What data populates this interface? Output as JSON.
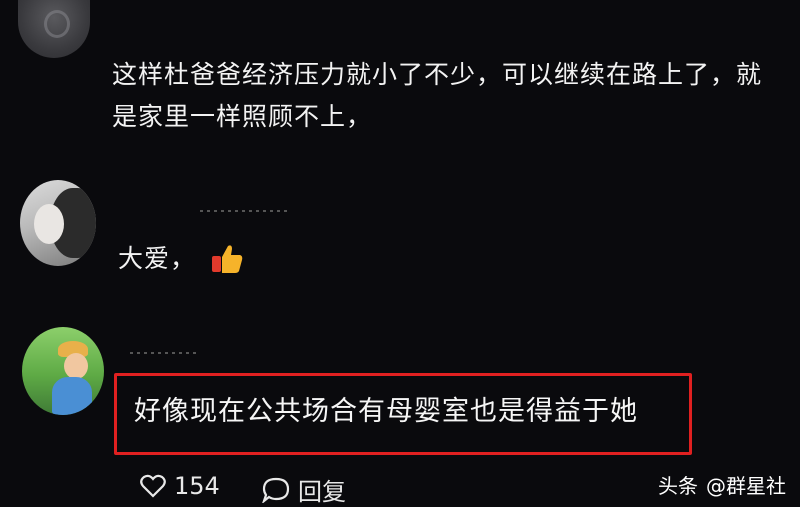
{
  "comments": [
    {
      "text_line1": "这样杜爸爸经济压力就小了不少，可以继续在路上了，就",
      "text_line2": "是家里一样照顾不上，"
    },
    {
      "text": "大爱，"
    },
    {
      "text": "好像现在公共场合有母婴室也是得益于她"
    }
  ],
  "actions": {
    "like_count": "154",
    "reply_label": "回复"
  },
  "watermark": {
    "platform": "头条",
    "account": "@群星社"
  },
  "colors": {
    "background": "#0a0a0d",
    "highlight": "#e02020"
  },
  "icons": [
    "heart-icon",
    "comment-bubble-icon",
    "thumbs-up-emoji"
  ]
}
